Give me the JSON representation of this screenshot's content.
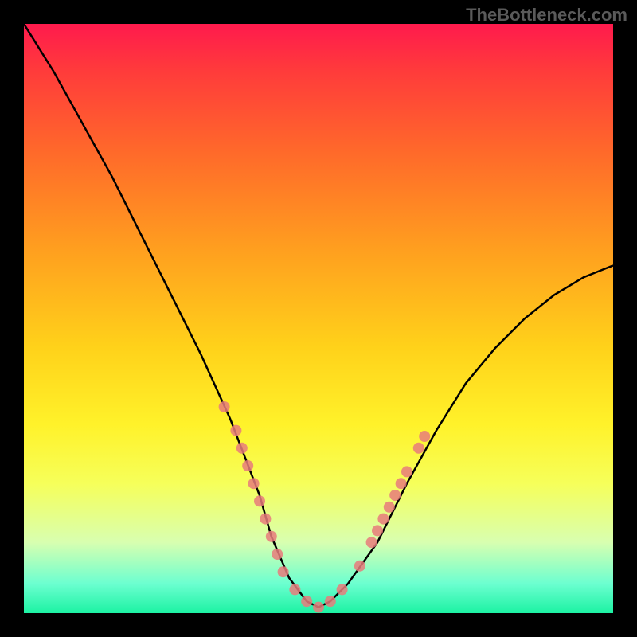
{
  "watermark": "TheBottleneck.com",
  "chart_data": {
    "type": "line",
    "title": "",
    "xlabel": "",
    "ylabel": "",
    "xlim": [
      0,
      100
    ],
    "ylim": [
      0,
      100
    ],
    "annotations": [],
    "background_gradient_stops": [
      {
        "pos": 0,
        "color": "#ff1a4d"
      },
      {
        "pos": 55,
        "color": "#ffd21a"
      },
      {
        "pos": 100,
        "color": "#1cf2a3"
      }
    ],
    "series": [
      {
        "name": "bottleneck-curve",
        "color": "#000000",
        "x": [
          0,
          5,
          10,
          15,
          20,
          25,
          30,
          35,
          40,
          42,
          45,
          48,
          50,
          52,
          55,
          60,
          65,
          70,
          75,
          80,
          85,
          90,
          95,
          100
        ],
        "values": [
          100,
          92,
          83,
          74,
          64,
          54,
          44,
          33,
          20,
          13,
          6,
          2,
          1,
          2,
          5,
          12,
          22,
          31,
          39,
          45,
          50,
          54,
          57,
          59
        ]
      }
    ],
    "markers": {
      "name": "highlighted-points",
      "color": "#e77b7b",
      "points": [
        {
          "x": 34,
          "y": 35
        },
        {
          "x": 36,
          "y": 31
        },
        {
          "x": 37,
          "y": 28
        },
        {
          "x": 38,
          "y": 25
        },
        {
          "x": 39,
          "y": 22
        },
        {
          "x": 40,
          "y": 19
        },
        {
          "x": 41,
          "y": 16
        },
        {
          "x": 42,
          "y": 13
        },
        {
          "x": 43,
          "y": 10
        },
        {
          "x": 44,
          "y": 7
        },
        {
          "x": 46,
          "y": 4
        },
        {
          "x": 48,
          "y": 2
        },
        {
          "x": 50,
          "y": 1
        },
        {
          "x": 52,
          "y": 2
        },
        {
          "x": 54,
          "y": 4
        },
        {
          "x": 57,
          "y": 8
        },
        {
          "x": 59,
          "y": 12
        },
        {
          "x": 60,
          "y": 14
        },
        {
          "x": 61,
          "y": 16
        },
        {
          "x": 62,
          "y": 18
        },
        {
          "x": 63,
          "y": 20
        },
        {
          "x": 64,
          "y": 22
        },
        {
          "x": 65,
          "y": 24
        },
        {
          "x": 67,
          "y": 28
        },
        {
          "x": 68,
          "y": 30
        }
      ]
    }
  }
}
